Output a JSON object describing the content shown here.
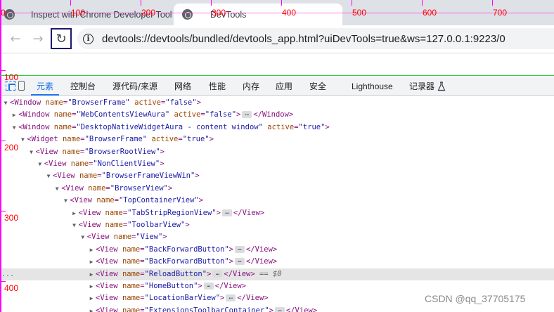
{
  "tabs": [
    {
      "title": "Inspect with Chrome Developer Tools",
      "icon": "globe-icon"
    },
    {
      "title": "DevTools",
      "icon": "globe-icon"
    }
  ],
  "toolbar": {
    "url": "devtools://devtools/bundled/devtools_app.html?uiDevTools=true&ws=127.0.0.1:9223/0"
  },
  "ruler": {
    "x_labels": [
      "0",
      "100",
      "200",
      "300",
      "400",
      "500",
      "600",
      "700"
    ],
    "y_labels": [
      "0",
      "100",
      "200",
      "300",
      "400"
    ]
  },
  "devtools": {
    "tabs": [
      {
        "label": "元素",
        "active": true
      },
      {
        "label": "控制台"
      },
      {
        "label": "源代码/来源"
      },
      {
        "label": "网络"
      },
      {
        "label": "性能"
      },
      {
        "label": "内存"
      },
      {
        "label": "应用"
      },
      {
        "label": "安全"
      },
      {
        "label": "Lighthouse"
      },
      {
        "label": "记录器"
      }
    ]
  },
  "tree": [
    {
      "indent": 0,
      "arrow": "down",
      "tag": "Window",
      "attrs": [
        [
          "name",
          "BrowserFrame"
        ],
        [
          "active",
          "false"
        ]
      ],
      "collapsed": false
    },
    {
      "indent": 1,
      "arrow": "right",
      "tag": "Window",
      "attrs": [
        [
          "name",
          "WebContentsViewAura"
        ],
        [
          "active",
          "false"
        ]
      ],
      "collapsed": true,
      "close": "</Window>"
    },
    {
      "indent": 1,
      "arrow": "down",
      "tag": "Window",
      "attrs": [
        [
          "name",
          "DesktopNativeWidgetAura - content window"
        ],
        [
          "active",
          "true"
        ]
      ],
      "collapsed": false
    },
    {
      "indent": 2,
      "arrow": "down",
      "tag": "Widget",
      "attrs": [
        [
          "name",
          "BrowserFrame"
        ],
        [
          "active",
          "true"
        ]
      ],
      "collapsed": false
    },
    {
      "indent": 3,
      "arrow": "down",
      "tag": "View",
      "attrs": [
        [
          "name",
          "BrowserRootView"
        ]
      ],
      "collapsed": false
    },
    {
      "indent": 4,
      "arrow": "down",
      "tag": "View",
      "attrs": [
        [
          "name",
          "NonClientView"
        ]
      ],
      "collapsed": false
    },
    {
      "indent": 5,
      "arrow": "down",
      "tag": "View",
      "attrs": [
        [
          "name",
          "BrowserFrameViewWin"
        ]
      ],
      "collapsed": false
    },
    {
      "indent": 6,
      "arrow": "down",
      "tag": "View",
      "attrs": [
        [
          "name",
          "BrowserView"
        ]
      ],
      "collapsed": false
    },
    {
      "indent": 7,
      "arrow": "down",
      "tag": "View",
      "attrs": [
        [
          "name",
          "TopContainerView"
        ]
      ],
      "collapsed": false
    },
    {
      "indent": 8,
      "arrow": "right",
      "tag": "View",
      "attrs": [
        [
          "name",
          "TabStripRegionView"
        ]
      ],
      "collapsed": true,
      "close": "</View>"
    },
    {
      "indent": 8,
      "arrow": "down",
      "tag": "View",
      "attrs": [
        [
          "name",
          "ToolbarView"
        ]
      ],
      "collapsed": false
    },
    {
      "indent": 9,
      "arrow": "down",
      "tag": "View",
      "attrs": [
        [
          "name",
          "View"
        ]
      ],
      "collapsed": false
    },
    {
      "indent": 10,
      "arrow": "right",
      "tag": "View",
      "attrs": [
        [
          "name",
          "BackForwardButton"
        ]
      ],
      "collapsed": true,
      "close": "</View>"
    },
    {
      "indent": 10,
      "arrow": "right",
      "tag": "View",
      "attrs": [
        [
          "name",
          "BackForwardButton"
        ]
      ],
      "collapsed": true,
      "close": "</View>"
    },
    {
      "indent": 10,
      "arrow": "right",
      "tag": "View",
      "attrs": [
        [
          "name",
          "ReloadButton"
        ]
      ],
      "collapsed": true,
      "close": "</View>",
      "selected": true,
      "suffix": "== $0"
    },
    {
      "indent": 10,
      "arrow": "right",
      "tag": "View",
      "attrs": [
        [
          "name",
          "HomeButton"
        ]
      ],
      "collapsed": true,
      "close": "</View>"
    },
    {
      "indent": 10,
      "arrow": "right",
      "tag": "View",
      "attrs": [
        [
          "name",
          "LocationBarView"
        ]
      ],
      "collapsed": true,
      "close": "</View>"
    },
    {
      "indent": 10,
      "arrow": "right",
      "tag": "View",
      "attrs": [
        [
          "name",
          "ExtensionsToolbarContainer"
        ]
      ],
      "collapsed": true,
      "close": "</View>"
    }
  ],
  "selected_row_marker": "...",
  "watermark": "CSDN @qq_37705175"
}
